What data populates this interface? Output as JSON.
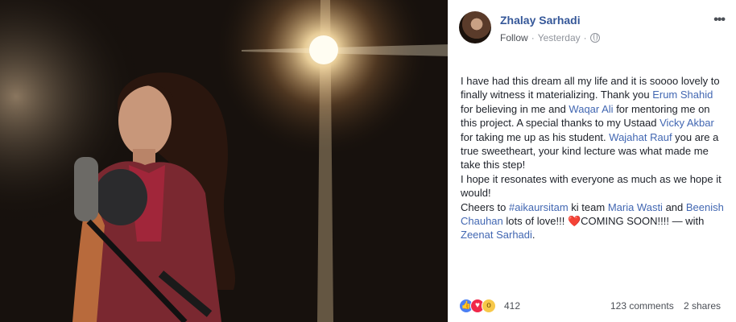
{
  "post": {
    "author": "Zhalay Sarhadi",
    "follow": "Follow",
    "separator": "·",
    "time": "Yesterday",
    "visibility_icon": "globe-icon",
    "more_icon": "ellipsis-icon",
    "text": {
      "l1": "I have had this dream all my life and it is soooo lovely to finally witness it materializing. Thank you ",
      "link_erum": "Erum Shahid",
      "l2": " for believing in me and ",
      "link_waqar": "Waqar Ali",
      "l3": " for mentoring me on this project. A special thanks to my Ustaad ",
      "link_vicky": "Vicky Akbar",
      "l4": " for taking me up as his student. ",
      "link_wajahat": "Wajahat Rauf",
      "l5": " you are a true sweetheart, your kind lecture was what made me take this step!",
      "l6": "I hope it resonates with everyone as much as we hope it would!",
      "l7a": "Cheers to ",
      "link_hashtag": "#aikaursitam",
      "l7b": " ki team ",
      "link_maria": "Maria Wasti",
      "l7c": " and ",
      "link_beenish": "Beenish Chauhan",
      "l7d": " lots of love!!! ",
      "heart": "❤️",
      "l7e": "COMING SOON!!!! — with ",
      "link_zeenat": "Zeenat Sarhadi",
      "l7f": "."
    }
  },
  "engagement": {
    "reaction_icons": [
      "like-icon",
      "love-icon",
      "wow-icon"
    ],
    "reaction_count": "412",
    "comments": "123 comments",
    "shares": "2 shares"
  },
  "colors": {
    "link": "#4267b2",
    "author": "#365899",
    "meta": "#90949c"
  }
}
